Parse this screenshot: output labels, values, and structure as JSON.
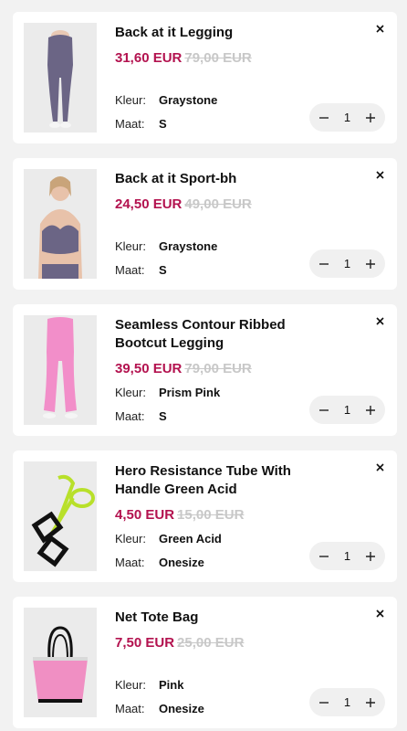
{
  "labels": {
    "color": "Kleur:",
    "size": "Maat:"
  },
  "accent_color": "#b3124f",
  "icons": {
    "remove": "close-icon",
    "decrease": "minus-icon",
    "increase": "plus-icon"
  },
  "items": [
    {
      "title": "Back at it Legging",
      "price": "31,60 EUR",
      "old_price": "79,00 EUR",
      "color": "Graystone",
      "size": "S",
      "qty": "1",
      "image": "purple-legging-image"
    },
    {
      "title": "Back at it Sport-bh",
      "price": "24,50 EUR",
      "old_price": "49,00 EUR",
      "color": "Graystone",
      "size": "S",
      "qty": "1",
      "image": "purple-sports-bra-image"
    },
    {
      "title": "Seamless Contour Ribbed Bootcut Legging",
      "price": "39,50 EUR",
      "old_price": "79,00 EUR",
      "color": "Prism Pink",
      "size": "S",
      "qty": "1",
      "image": "pink-bootcut-legging-image"
    },
    {
      "title": "Hero Resistance Tube With Handle Green Acid",
      "price": "4,50 EUR",
      "old_price": "15,00 EUR",
      "color": "Green Acid",
      "size": "Onesize",
      "qty": "1",
      "image": "green-resistance-tube-image"
    },
    {
      "title": "Net Tote Bag",
      "price": "7,50 EUR",
      "old_price": "25,00 EUR",
      "color": "Pink",
      "size": "Onesize",
      "qty": "1",
      "image": "pink-tote-bag-image"
    }
  ]
}
